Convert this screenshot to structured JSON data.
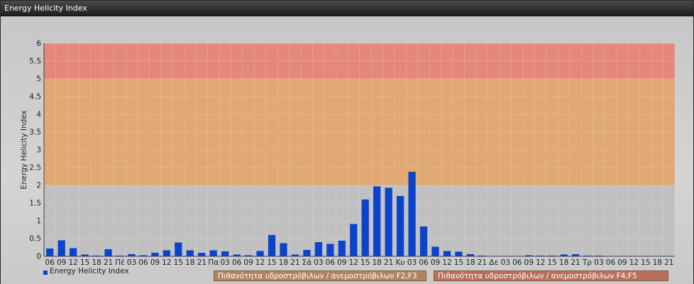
{
  "window": {
    "title": "Energy Helicity Index"
  },
  "colors": {
    "bar": "#0a43cc",
    "band_low": "#bfbfbf",
    "band_mid": "#e0a874",
    "band_high": "#e4887a"
  },
  "legend": {
    "series_label": "Energy Helicity Index",
    "band_mid_label": "Πιθανότητα υδροστρόβιλων / ανεμοστρόβιλων F2,F3",
    "band_high_label": "Πιθανότητα υδροστρόβιλων / ανεμοστρόβιλων F4,F5"
  },
  "chart_data": {
    "type": "bar",
    "title": "",
    "xlabel": "",
    "ylabel": "Energy Helicity Index",
    "ylim": [
      0,
      6
    ],
    "yticks": [
      "0",
      "0.5",
      "1",
      "1.5",
      "2",
      "2.5",
      "3",
      "3.5",
      "4",
      "4.5",
      "5",
      "5.5",
      "6"
    ],
    "bands": [
      {
        "from": 0,
        "to": 2,
        "color": "#c0c0c0"
      },
      {
        "from": 2,
        "to": 5,
        "color": "#e0a874"
      },
      {
        "from": 5,
        "to": 6,
        "color": "#e4887a"
      }
    ],
    "categories": [
      "06",
      "09",
      "12",
      "15",
      "18",
      "21",
      "Πέ",
      "03",
      "06",
      "09",
      "12",
      "15",
      "18",
      "21",
      "Πα",
      "03",
      "06",
      "09",
      "12",
      "15",
      "18",
      "21",
      "Σά",
      "03",
      "06",
      "09",
      "12",
      "15",
      "18",
      "21",
      "Κυ",
      "03",
      "06",
      "09",
      "12",
      "15",
      "18",
      "21",
      "Δε",
      "03",
      "06",
      "09",
      "12",
      "15",
      "18",
      "21",
      "Τρ",
      "03",
      "06",
      "09",
      "12",
      "15",
      "18",
      "21"
    ],
    "series": [
      {
        "name": "Energy Helicity Index",
        "values": [
          0.22,
          0.45,
          0.23,
          0.05,
          0.02,
          0.2,
          0.02,
          0.06,
          0.03,
          0.1,
          0.17,
          0.39,
          0.17,
          0.1,
          0.17,
          0.14,
          0.05,
          0.03,
          0.15,
          0.6,
          0.37,
          0.05,
          0.18,
          0.4,
          0.35,
          0.44,
          0.91,
          1.6,
          1.97,
          1.93,
          1.7,
          2.38,
          0.84,
          0.27,
          0.15,
          0.13,
          0.06,
          0.02,
          0.01,
          0.01,
          0.01,
          0.03,
          0.02,
          0.02,
          0.05,
          0.06,
          0.02,
          0.02,
          0.01,
          0.01,
          0.01,
          0.01,
          0.01,
          0.01
        ]
      }
    ]
  }
}
